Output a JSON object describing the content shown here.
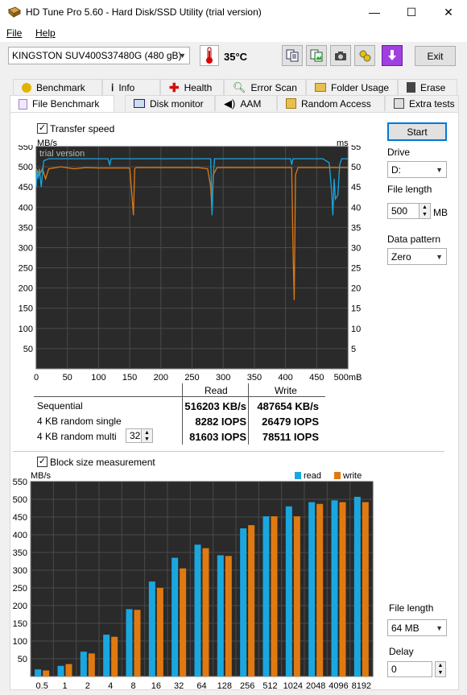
{
  "window": {
    "title": "HD Tune Pro 5.60 - Hard Disk/SSD Utility (trial version)",
    "controls": {
      "minimize": "—",
      "maximize": "☐",
      "close": "✕"
    }
  },
  "menu": {
    "file": "File",
    "help": "Help"
  },
  "toolbar": {
    "drive_select": "KINGSTON SUV400S37480G (480 gB)",
    "temperature": "35°C",
    "exit_label": "Exit",
    "icons": [
      "copy-text-icon",
      "copy-image-icon",
      "camera-icon",
      "options-icon",
      "save-download-icon"
    ]
  },
  "tabs_row1": [
    {
      "label": "Benchmark",
      "icon": "benchmark-icon"
    },
    {
      "label": "Info",
      "icon": "info-icon"
    },
    {
      "label": "Health",
      "icon": "health-icon"
    },
    {
      "label": "Error Scan",
      "icon": "error-scan-icon"
    },
    {
      "label": "Folder Usage",
      "icon": "folder-icon"
    },
    {
      "label": "Erase",
      "icon": "trash-icon"
    }
  ],
  "tabs_row2": [
    {
      "label": "File Benchmark",
      "icon": "file-benchmark-icon",
      "active": true
    },
    {
      "label": "Disk monitor",
      "icon": "disk-monitor-icon"
    },
    {
      "label": "AAM",
      "icon": "speaker-icon"
    },
    {
      "label": "Random Access",
      "icon": "random-access-icon"
    },
    {
      "label": "Extra tests",
      "icon": "extra-tests-icon"
    }
  ],
  "file_benchmark": {
    "transfer_speed_label": "Transfer speed",
    "transfer_speed_checked": true,
    "start_label": "Start",
    "drive_label": "Drive",
    "drive_value": "D:",
    "file_length_label": "File length",
    "file_length_value": "500",
    "file_length_unit": "MB",
    "data_pattern_label": "Data pattern",
    "data_pattern_value": "Zero",
    "watermark": "trial version"
  },
  "results": {
    "headers": [
      "Read",
      "Write"
    ],
    "rows": [
      {
        "label": "Sequential",
        "read": "516203 KB/s",
        "write": "487654 KB/s"
      },
      {
        "label": "4 KB random single",
        "read": "8282 IOPS",
        "write": "26479 IOPS"
      },
      {
        "label": "4 KB random multi",
        "read": "81603 IOPS",
        "write": "78511 IOPS",
        "queue_depth": "32"
      }
    ]
  },
  "block_size": {
    "label": "Block size measurement",
    "checked": true,
    "file_length_label": "File length",
    "file_length_value": "64 MB",
    "delay_label": "Delay",
    "delay_value": "0"
  },
  "colors": {
    "read": "#1aa7e0",
    "write": "#e07a10",
    "chart_bg": "#2a2a2a",
    "grid": "#4a4a4a"
  },
  "chart_data": [
    {
      "type": "line",
      "ylabel_left": "MB/s",
      "ylabel_right": "ms",
      "xlabel_unit": "mB",
      "x_ticks": [
        "0",
        "50",
        "100",
        "150",
        "200",
        "250",
        "300",
        "350",
        "400",
        "450",
        "500mB"
      ],
      "y_ticks_left": [
        "50",
        "100",
        "150",
        "200",
        "250",
        "300",
        "350",
        "400",
        "450",
        "500",
        "550"
      ],
      "y_ticks_right": [
        "5",
        "10",
        "15",
        "20",
        "25",
        "30",
        "35",
        "40",
        "45",
        "50",
        "55"
      ],
      "xlim": [
        0,
        500
      ],
      "ylim": [
        0,
        550
      ],
      "series": [
        {
          "name": "read",
          "x": [
            0,
            1,
            3,
            5,
            8,
            12,
            20,
            40,
            60,
            80,
            100,
            115,
            118,
            120,
            140,
            160,
            180,
            200,
            240,
            270,
            280,
            282,
            284,
            286,
            300,
            330,
            360,
            380,
            400,
            408,
            410,
            412,
            420,
            440,
            460,
            470,
            474,
            476,
            478,
            480,
            484,
            487,
            490,
            500
          ],
          "y": [
            450,
            490,
            470,
            495,
            450,
            515,
            520,
            520,
            520,
            520,
            520,
            520,
            505,
            520,
            520,
            520,
            520,
            520,
            520,
            520,
            520,
            380,
            470,
            520,
            520,
            520,
            520,
            520,
            520,
            520,
            505,
            520,
            520,
            520,
            520,
            510,
            440,
            380,
            470,
            420,
            430,
            505,
            520,
            520
          ]
        },
        {
          "name": "write",
          "x": [
            0,
            2,
            5,
            10,
            15,
            20,
            40,
            60,
            80,
            100,
            150,
            155,
            156,
            158,
            160,
            200,
            260,
            275,
            280,
            282,
            284,
            290,
            300,
            350,
            400,
            410,
            412,
            414,
            416,
            420,
            440,
            450,
            460,
            470,
            480,
            490,
            500
          ],
          "y": [
            495,
            490,
            480,
            495,
            470,
            495,
            500,
            495,
            498,
            497,
            497,
            400,
            380,
            495,
            498,
            498,
            498,
            495,
            450,
            390,
            480,
            498,
            498,
            498,
            498,
            498,
            300,
            170,
            480,
            498,
            498,
            498,
            498,
            498,
            498,
            498,
            498
          ]
        }
      ]
    },
    {
      "type": "bar",
      "ylabel": "MB/s",
      "legend": [
        "read",
        "write"
      ],
      "legend_position": "top-right",
      "categories": [
        "0.5",
        "1",
        "2",
        "4",
        "8",
        "16",
        "32",
        "64",
        "128",
        "256",
        "512",
        "1024",
        "2048",
        "4096",
        "8192"
      ],
      "ylim": [
        0,
        550
      ],
      "y_ticks": [
        "50",
        "100",
        "150",
        "200",
        "250",
        "300",
        "350",
        "400",
        "450",
        "500",
        "550"
      ],
      "series": [
        {
          "name": "read",
          "values": [
            20,
            30,
            70,
            118,
            190,
            268,
            335,
            372,
            342,
            418,
            452,
            480,
            492,
            497,
            507
          ]
        },
        {
          "name": "write",
          "values": [
            17,
            35,
            65,
            112,
            188,
            250,
            305,
            362,
            340,
            427,
            452,
            452,
            487,
            492,
            492
          ]
        }
      ]
    }
  ]
}
